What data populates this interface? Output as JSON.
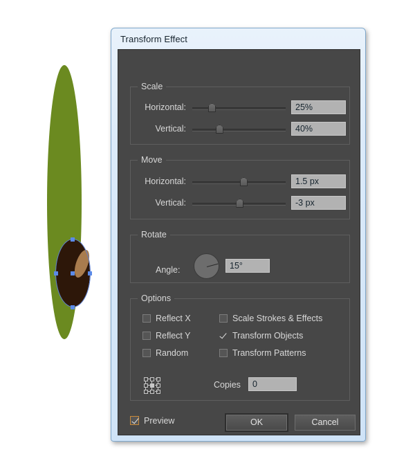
{
  "dialog": {
    "title": "Transform Effect"
  },
  "scale": {
    "group_label": "Scale",
    "horizontal_label": "Horizontal:",
    "horizontal_value": "25%",
    "horizontal_slider_pct": 17,
    "vertical_label": "Vertical:",
    "vertical_value": "40%",
    "vertical_slider_pct": 25
  },
  "move": {
    "group_label": "Move",
    "horizontal_label": "Horizontal:",
    "horizontal_value": "1.5 px",
    "horizontal_slider_pct": 51,
    "vertical_label": "Vertical:",
    "vertical_value": "-3 px",
    "vertical_slider_pct": 47
  },
  "rotate": {
    "group_label": "Rotate",
    "angle_label": "Angle:",
    "angle_value": "15°",
    "dial_icon": "angle-dial-icon"
  },
  "options": {
    "group_label": "Options",
    "items": [
      {
        "label": "Reflect X",
        "checked": false
      },
      {
        "label": "Reflect Y",
        "checked": false
      },
      {
        "label": "Random",
        "checked": false
      },
      {
        "label": "Scale Strokes & Effects",
        "checked": false
      },
      {
        "label": "Transform Objects",
        "checked": true
      },
      {
        "label": "Transform Patterns",
        "checked": false
      }
    ],
    "anchor_icon": "reference-point-grid-icon",
    "copies_label": "Copies",
    "copies_value": "0"
  },
  "footer": {
    "preview_label": "Preview",
    "preview_checked": true,
    "ok_label": "OK",
    "cancel_label": "Cancel"
  },
  "artwork": {
    "leaf_shape": "green-leaf-ellipse",
    "leaf_color": "#6b8a20",
    "seed_shape": "brown-seed-ellipse",
    "seed_color": "#2d1709",
    "seed_highlight_color": "#a97c4e",
    "selection_color": "#5b8ae8"
  },
  "colors": {
    "dialog_chrome": "#cfe3f7",
    "panel_background": "#474747",
    "field_background": "#b2b2b2",
    "text": "#d8d8d8",
    "focus_accent": "#c98a3a"
  }
}
